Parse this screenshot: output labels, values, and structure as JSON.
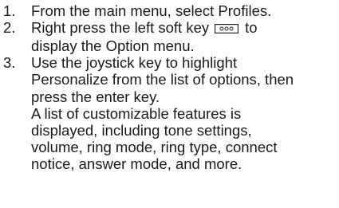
{
  "clipped_heading": "preceding text partially cut off at top",
  "steps": [
    {
      "number": "1.",
      "text": "From the main menu, select Profiles."
    },
    {
      "number": "2.",
      "text_before_key": "Right press the left soft key",
      "key_icon": "soft-key-icon",
      "text_after_key_line1": "to",
      "text_line2": "display the Option menu."
    },
    {
      "number": "3.",
      "text_line1": "Use the joystick key to highlight",
      "text_line2": "Personalize from the list of options, then",
      "text_line3": "press the enter key.",
      "note_line1": "A list of customizable features is",
      "note_line2": "displayed, including tone settings,",
      "note_line3": "volume, ring mode, ring type, connect",
      "note_line4": "notice, answer mode, and more."
    }
  ]
}
